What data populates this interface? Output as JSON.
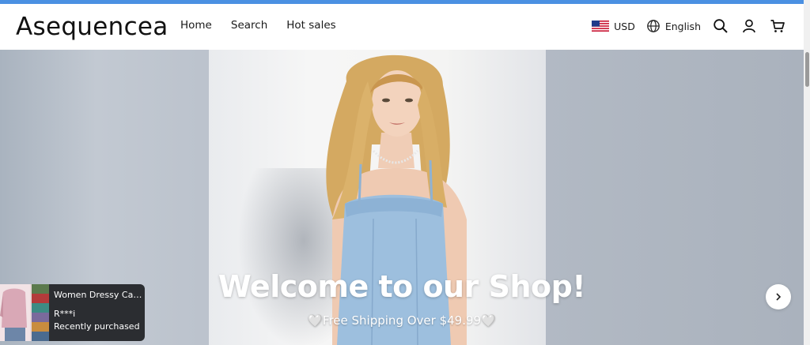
{
  "header": {
    "logo": "Asequencea",
    "nav": [
      {
        "label": "Home"
      },
      {
        "label": "Search"
      },
      {
        "label": "Hot sales"
      }
    ],
    "currency": "USD",
    "language": "English",
    "icons": [
      "us-flag-icon",
      "globe-icon",
      "search-icon",
      "user-icon",
      "cart-icon"
    ]
  },
  "hero": {
    "title": "Welcome to our Shop!",
    "subtitle": "🤍Free Shipping Over $49.99🤍"
  },
  "popup": {
    "product": "Women Dressy Cas...",
    "user": "R***i",
    "status": "Recently purchased"
  },
  "colors": {
    "top_bar": "#4a90e2",
    "popup_bg": "#2b2d31"
  }
}
